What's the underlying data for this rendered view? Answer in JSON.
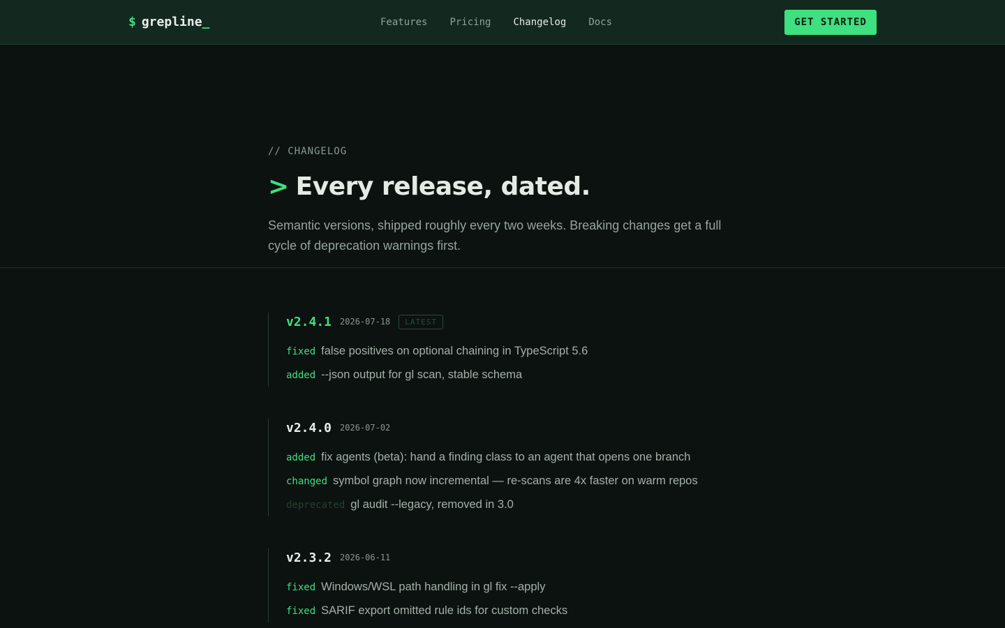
{
  "nav": {
    "brand_prompt": "$",
    "brand_name": "grepline",
    "brand_cursor": "_",
    "links": [
      "Features",
      "Pricing",
      "Changelog",
      "Docs"
    ],
    "active_link": "Changelog",
    "cta": "GET STARTED"
  },
  "hero": {
    "eyebrow": "// CHANGELOG",
    "title_prompt": ">",
    "title": "Every release, dated.",
    "subtitle": "Semantic versions, shipped roughly every two weeks. Breaking changes get a full cycle of deprecation warnings first."
  },
  "releases": [
    {
      "version": "v2.4.1",
      "date": "2026-07-18",
      "badge": "LATEST",
      "entries": [
        {
          "kind": "fixed",
          "text": "false positives on optional chaining in TypeScript 5.6"
        },
        {
          "kind": "added",
          "text": "--json output for gl scan, stable schema"
        }
      ]
    },
    {
      "version": "v2.4.0",
      "date": "2026-07-02",
      "entries": [
        {
          "kind": "added",
          "text": "fix agents (beta): hand a finding class to an agent that opens one branch"
        },
        {
          "kind": "changed",
          "text": "symbol graph now incremental — re-scans are 4x faster on warm repos"
        },
        {
          "kind": "deprecated",
          "text": "gl audit --legacy, removed in 3.0"
        }
      ]
    },
    {
      "version": "v2.3.2",
      "date": "2026-06-11",
      "entries": [
        {
          "kind": "fixed",
          "text": "Windows/WSL path handling in gl fix --apply"
        },
        {
          "kind": "fixed",
          "text": "SARIF export omitted rule ids for custom checks"
        }
      ]
    }
  ],
  "colors": {
    "accent": "#3ee07f",
    "background": "#0c1210",
    "nav_background": "#13291f"
  }
}
